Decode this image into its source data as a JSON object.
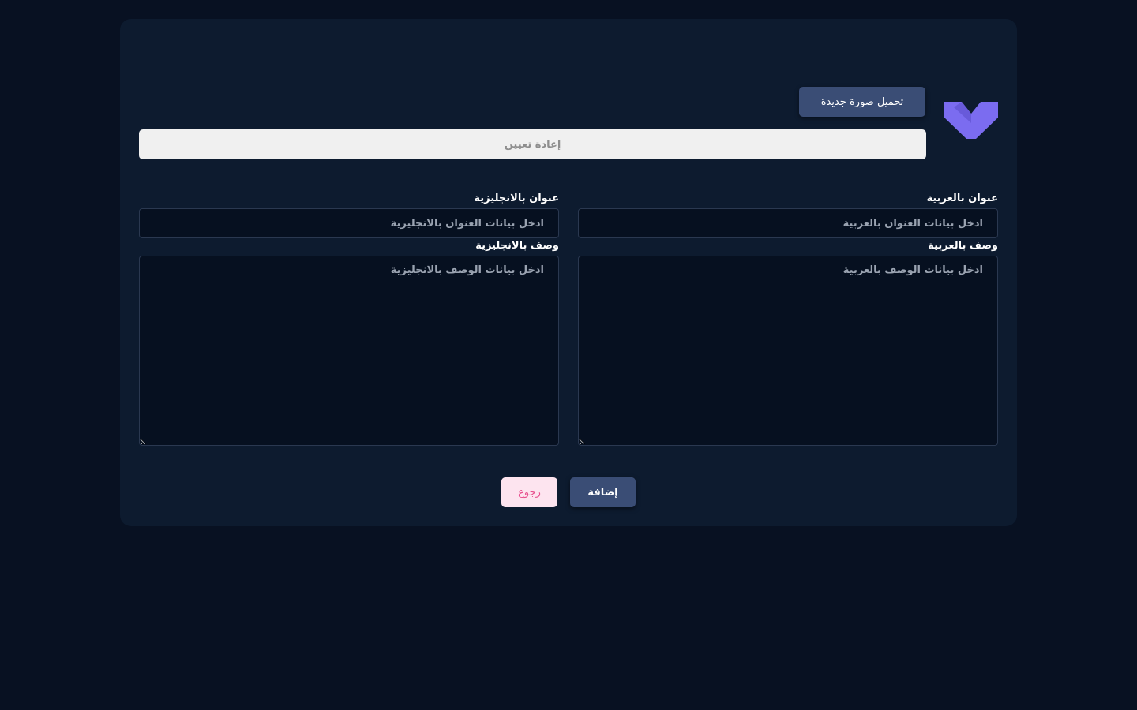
{
  "colors": {
    "page_bg": "#081122",
    "card_bg": "#0d1b2f",
    "primary_button": "#3a4d75",
    "logo": "#7b6cf0",
    "back_button_bg": "#fde4ef",
    "back_button_text": "#e8508e"
  },
  "header": {
    "logo_icon": "chevron-check-icon",
    "upload_label": "تحميل صورة جديدة",
    "reset_label": "إعادة تعيين"
  },
  "form": {
    "title_ar": {
      "label": "عنوان بالعربية",
      "value": "",
      "placeholder": "ادخل بيانات العنوان بالعربية"
    },
    "title_en": {
      "label": "عنوان بالانجليزية",
      "value": "",
      "placeholder": "ادخل بيانات العنوان بالانجليزية"
    },
    "desc_ar": {
      "label": "وصف بالعربية",
      "value": "",
      "placeholder": "ادخل بيانات الوصف بالعربية"
    },
    "desc_en": {
      "label": "وصف بالانجليزية",
      "value": "",
      "placeholder": "ادخل بيانات الوصف بالانجليزية"
    }
  },
  "actions": {
    "submit_label": "إضافة",
    "back_label": "رجوع"
  }
}
